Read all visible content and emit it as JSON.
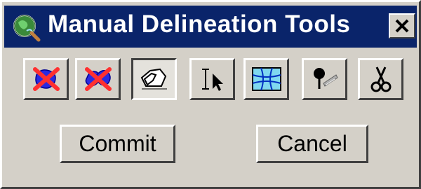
{
  "window": {
    "title": "Manual Delineation Tools",
    "title_bar_color": "#0a246a",
    "face_color": "#d4d0c8"
  },
  "toolbar": {
    "tools": [
      {
        "icon": "delete-polygon-icon"
      },
      {
        "icon": "delete-multiple-polygons-icon"
      },
      {
        "icon": "draw-polygon-icon",
        "state": "pressed"
      },
      {
        "icon": "select-cursor-icon"
      },
      {
        "icon": "grid-delineation-icon"
      },
      {
        "icon": "pin-point-icon"
      },
      {
        "icon": "scissors-icon"
      }
    ]
  },
  "actions": {
    "commit_label": "Commit",
    "cancel_label": "Cancel"
  }
}
